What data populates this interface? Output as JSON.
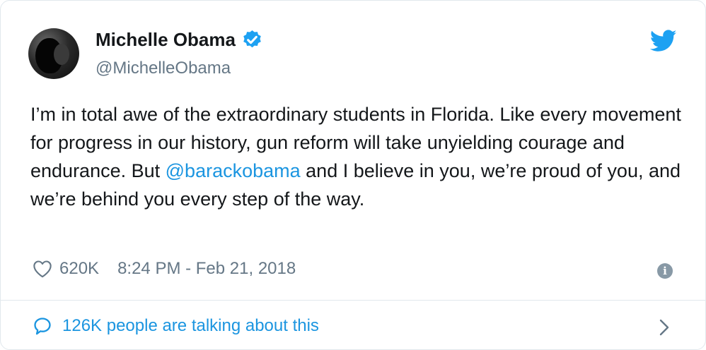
{
  "author": {
    "name": "Michelle Obama",
    "handle": "@MichelleObama"
  },
  "tweet": {
    "text_before_mention": "I’m in total awe of the extraordinary students in Florida. Like every movement for progress in our history, gun reform will take unyielding courage and endurance. But ",
    "mention": "@barackobama",
    "text_after_mention": " and I believe in you, we’re proud of you, and we’re behind you every step of the way."
  },
  "meta": {
    "likes": "620K",
    "timestamp": "8:24 PM - Feb 21, 2018"
  },
  "footer": {
    "talking": "126K people are talking about this"
  },
  "colors": {
    "link": "#1b95e0",
    "muted": "#657786",
    "text": "#14171a",
    "border": "#e1e8ed"
  },
  "icons": [
    "verified-badge-icon",
    "twitter-bird-icon",
    "heart-icon",
    "info-icon",
    "reply-bubble-icon",
    "chevron-right-icon"
  ]
}
